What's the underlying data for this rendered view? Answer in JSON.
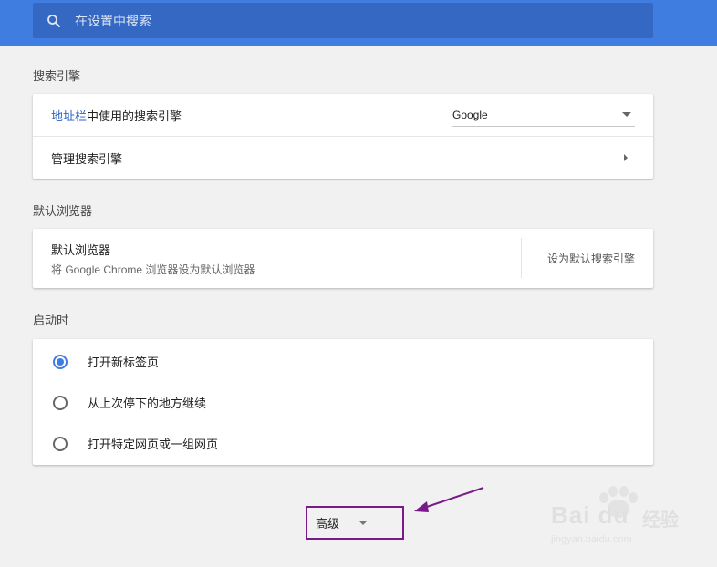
{
  "search": {
    "placeholder": "在设置中搜索"
  },
  "search_engine_section": {
    "title": "搜索引擎",
    "row1_link": "地址栏",
    "row1_rest": "中使用的搜索引擎",
    "selected_engine": "Google",
    "row2_label": "管理搜索引擎"
  },
  "default_browser_section": {
    "title": "默认浏览器",
    "heading": "默认浏览器",
    "subtext": "将 Google Chrome 浏览器设为默认浏览器",
    "action": "设为默认搜索引擎"
  },
  "startup_section": {
    "title": "启动时",
    "options": [
      {
        "label": "打开新标签页",
        "checked": true
      },
      {
        "label": "从上次停下的地方继续",
        "checked": false
      },
      {
        "label": "打开特定网页或一组网页",
        "checked": false
      }
    ]
  },
  "advanced": {
    "label": "高级"
  },
  "watermark": {
    "brand": "Bai du",
    "cn": "经验",
    "url": "jingyan.baidu.com"
  },
  "colors": {
    "accent": "#3f7de0",
    "highlight_box": "#7a1a8a"
  }
}
